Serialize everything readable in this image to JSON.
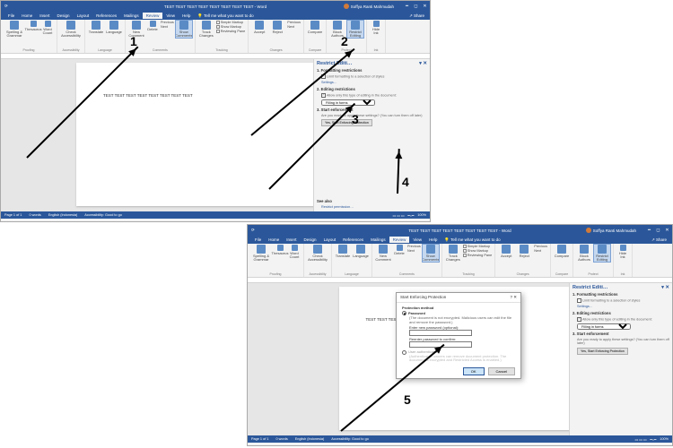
{
  "app": {
    "doc_title": "TEST TEST TEST TEST TEST TEST TEST TEST - Word",
    "user": "Soffya Ranti Mahmudah",
    "share": "Share",
    "tell_me": "Tell me what you want to do"
  },
  "tabs": [
    "File",
    "Home",
    "Insert",
    "Design",
    "Layout",
    "References",
    "Mailings",
    "Review",
    "View",
    "Help"
  ],
  "active_tab": "Review",
  "ribbon": {
    "proofing": {
      "label": "Proofing",
      "spelling": "Spelling & Grammar",
      "thesaurus": "Thesaurus",
      "wordcount": "Word Count"
    },
    "accessibility": {
      "label": "Accessibility",
      "check": "Check Accessibility"
    },
    "language": {
      "label": "Language",
      "translate": "Translate",
      "lang": "Language"
    },
    "comments": {
      "label": "Comments",
      "new": "New Comment",
      "delete": "Delete",
      "prev": "Previous",
      "next": "Next",
      "show": "Show Comments"
    },
    "tracking": {
      "label": "Tracking",
      "track": "Track Changes",
      "simple": "Simple Markup",
      "show_markup": "Show Markup",
      "reviewing": "Reviewing Pane"
    },
    "changes": {
      "label": "Changes",
      "accept": "Accept",
      "reject": "Reject",
      "prev": "Previous",
      "next": "Next"
    },
    "compare": {
      "label": "Compare",
      "compare": "Compare"
    },
    "protect": {
      "label": "Protect",
      "block": "Block Authors",
      "restrict": "Restrict Editing"
    },
    "ink": {
      "label": "Ink",
      "hide": "Hide Ink"
    }
  },
  "page_text": "TEST TEST TEST TEST TEST TEST TEST TEST",
  "pane": {
    "title": "Restrict Editi…",
    "s1": "1. Formatting restrictions",
    "s1_cb": "Limit formatting to a selection of styles",
    "s1_link": "Settings…",
    "s2": "2. Editing restrictions",
    "s2_cb": "Allow only this type of editing in the document:",
    "s2_opt": "Filling in forms",
    "s3": "3. Start enforcement",
    "s3_txt": "Are you ready to apply these settings? (You can turn them off later)",
    "s3_btn": "Yes, Start Enforcing Protection",
    "seealso": "See also",
    "restrict_perm": "Restrict permission…"
  },
  "status": {
    "page": "Page 1 of 1",
    "words": "0 words",
    "lang": "English (Indonesia)",
    "acc": "Accessibility: Good to go",
    "zoom": "100%"
  },
  "dialog": {
    "title": "Start Enforcing Protection",
    "method": "Protection method",
    "pw": "Password",
    "pw_note": "(The document is not encrypted. Malicious users can edit the file and remove the password.)",
    "enter": "Enter new password (optional):",
    "reenter": "Reenter password to confirm:",
    "auth": "User authentication",
    "auth_note": "(Authenticated owners can remove document protection. The document is encrypted and Restricted Access is enabled.)",
    "ok": "OK",
    "cancel": "Cancel"
  },
  "callouts": {
    "n1": "1",
    "n2": "2",
    "n3": "3",
    "n4": "4",
    "n5": "5"
  }
}
